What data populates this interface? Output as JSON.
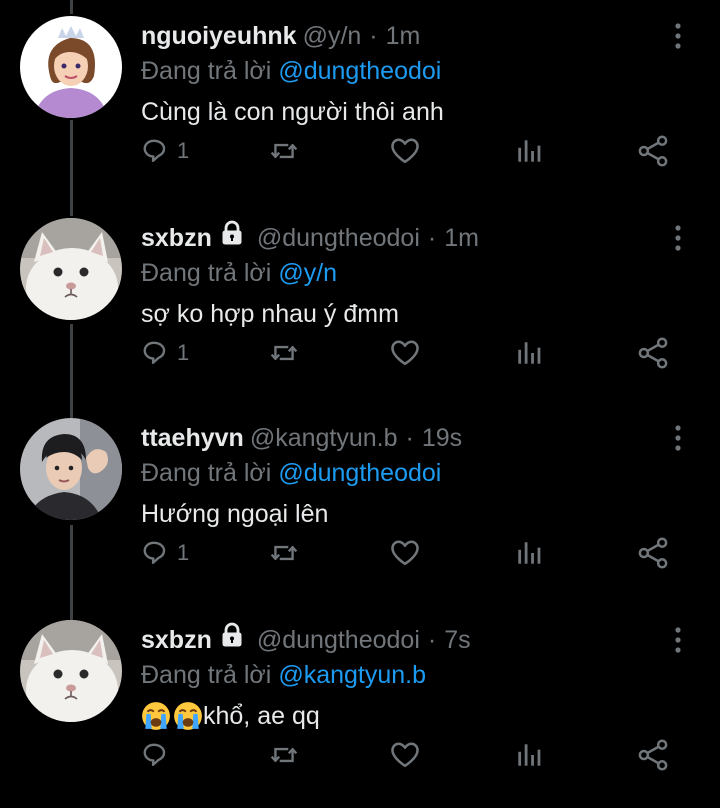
{
  "colors": {
    "background": "#000000",
    "text": "#e7e9ea",
    "muted": "#71767b",
    "accent": "#1d9bf0",
    "thread_line": "#3e4144"
  },
  "reply_prefix": "Đang trả lời",
  "tweets": [
    {
      "display_name": "nguoiyeuhnk",
      "handle": "@y/n",
      "separator": "·",
      "time": "1m",
      "protected": false,
      "reply_to": "@dungtheodoi",
      "text": "Cùng là con người thôi anh",
      "reply_count": "1",
      "avatar": "princess-avatar"
    },
    {
      "display_name": "sxbzn",
      "handle": "@dungtheodoi",
      "separator": "·",
      "time": "1m",
      "protected": true,
      "reply_to": "@y/n",
      "text": "sợ ko hợp nhau ý đmm",
      "reply_count": "1",
      "avatar": "cat-avatar"
    },
    {
      "display_name": "ttaehyvn",
      "handle": "@kangtyun.b",
      "separator": "·",
      "time": "19s",
      "protected": false,
      "reply_to": "@dungtheodoi",
      "text": "Hướng ngoại lên",
      "reply_count": "1",
      "avatar": "person-avatar"
    },
    {
      "display_name": "sxbzn",
      "handle": "@dungtheodoi",
      "separator": "·",
      "time": "7s",
      "protected": true,
      "reply_to": "@kangtyun.b",
      "text": "khổ, ae qq",
      "text_prefix_emoji": "loudly-crying-face ×2",
      "reply_count": "",
      "avatar": "cat-avatar"
    }
  ]
}
